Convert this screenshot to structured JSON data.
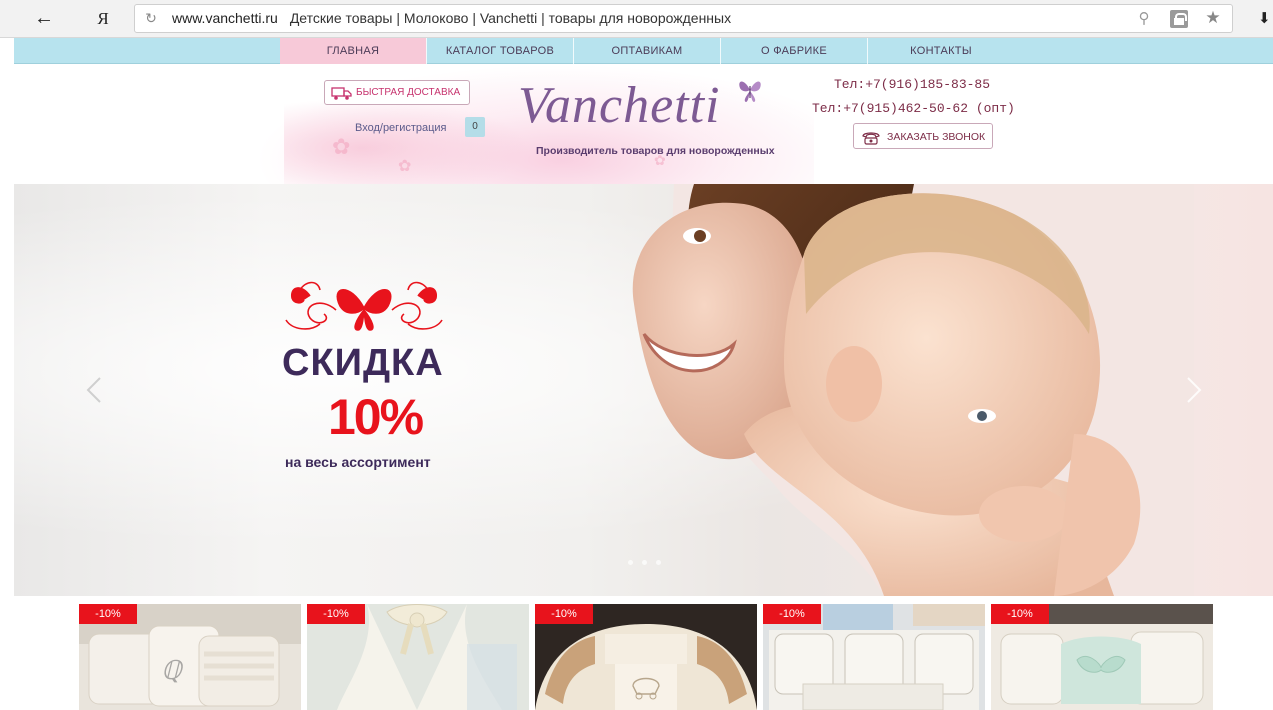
{
  "browser": {
    "url_domain": "www.vanchetti.ru",
    "page_title": "Детские товары | Молоково | Vanchetti | товары для новорожденных",
    "back_icon": "arrow-left-icon",
    "yandex_label": "Я"
  },
  "nav": {
    "items": [
      {
        "label": "ГЛАВНАЯ",
        "active": true
      },
      {
        "label": "КАТАЛОГ ТОВАРОВ",
        "active": false
      },
      {
        "label": "ОПТАВИКАМ",
        "active": false
      },
      {
        "label": "О ФАБРИКЕ",
        "active": false
      },
      {
        "label": "КОНТАКТЫ",
        "active": false
      }
    ]
  },
  "header": {
    "delivery_label": "БЫСТРАЯ ДОСТАВКА",
    "login_label": "Вход/регистрация",
    "cart_count": "0",
    "logo_text": "Vanchetti",
    "logo_tagline": "Производитель товаров для новорожденных",
    "phone_retail": "Тел:+7(916)185-83-85",
    "phone_wholesale": "Тел:+7(915)462-50-62 (опт)",
    "callback_label": "ЗАКАЗАТЬ ЗВОНОК"
  },
  "hero": {
    "promo_title": "СКИДКА",
    "promo_percent": "10%",
    "promo_subtitle": "на весь ассортимент",
    "slide_count": 3
  },
  "products": [
    {
      "badge": "-10%"
    },
    {
      "badge": "-10%"
    },
    {
      "badge": "-10%"
    },
    {
      "badge": "-10%"
    },
    {
      "badge": "-10%"
    }
  ],
  "colors": {
    "nav_bg": "#b7e3ee",
    "nav_active": "#f7c9d8",
    "promo_red": "#e8131c",
    "promo_purple": "#3d2a5a",
    "logo_purple": "#7d5a93"
  }
}
